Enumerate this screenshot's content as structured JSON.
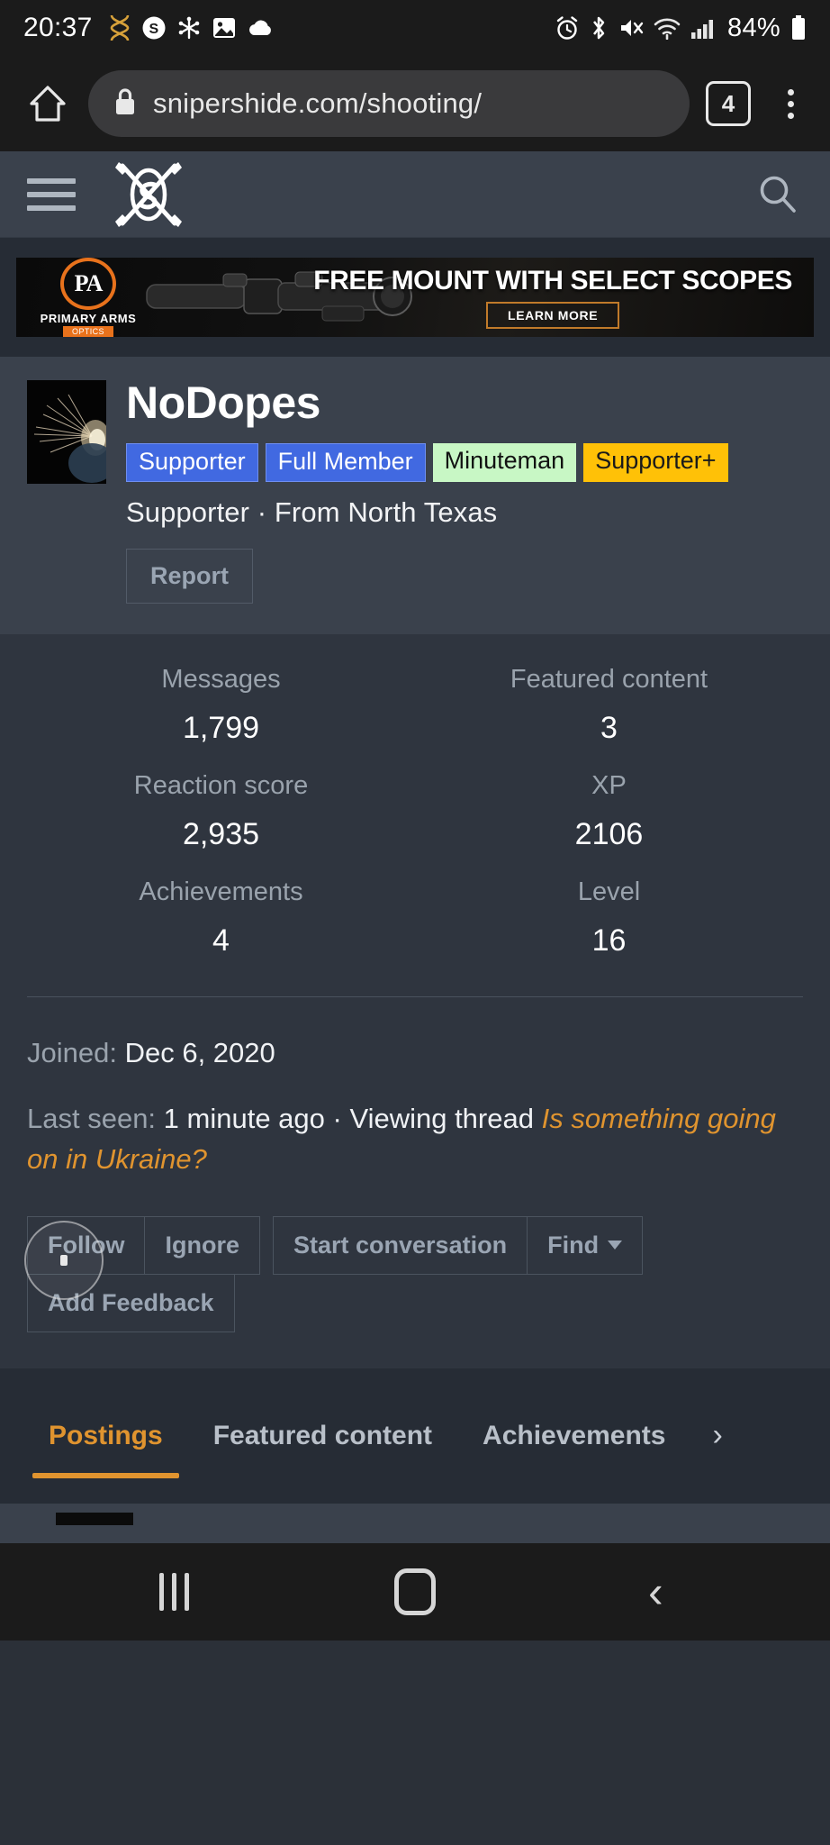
{
  "status_bar": {
    "time": "20:37",
    "left_icons": [
      "dna-icon",
      "s-circle-icon",
      "snowflake-icon",
      "photo-icon",
      "cloud-icon"
    ],
    "right_icons": [
      "alarm-icon",
      "bluetooth-icon",
      "mute-icon",
      "wifi-icon",
      "signal-icon"
    ],
    "battery_percent": "84%"
  },
  "browser": {
    "home_label": "home-icon",
    "lock_label": "lock-icon",
    "url": "snipershide.com/shooting/",
    "tab_count": "4",
    "menu_label": "more-options-icon"
  },
  "site_header": {
    "menu_label": "hamburger-icon",
    "logo_label": "snipers-hide-logo",
    "search_label": "search-icon"
  },
  "ad": {
    "brand_initials": "PA",
    "brand_name": "PRIMARY ARMS",
    "brand_sub": "OPTICS",
    "headline": "FREE MOUNT WITH SELECT SCOPES",
    "cta": "LEARN MORE"
  },
  "profile": {
    "username": "NoDopes",
    "badges": [
      {
        "label": "Supporter",
        "style": "blue"
      },
      {
        "label": "Full Member",
        "style": "blue"
      },
      {
        "label": "Minuteman",
        "style": "green"
      },
      {
        "label": "Supporter+",
        "style": "gold"
      }
    ],
    "title_line": "Supporter · From North Texas",
    "report_label": "Report"
  },
  "stats": [
    {
      "label": "Messages",
      "value": "1,799"
    },
    {
      "label": "Featured content",
      "value": "3"
    },
    {
      "label": "Reaction score",
      "value": "2,935"
    },
    {
      "label": "XP",
      "value": "2106"
    },
    {
      "label": "Achievements",
      "value": "4"
    },
    {
      "label": "Level",
      "value": "16"
    }
  ],
  "info": {
    "joined_label": "Joined:",
    "joined_value": "Dec 6, 2020",
    "last_seen_label": "Last seen:",
    "last_seen_value": "1 minute ago · Viewing thread ",
    "thread_title": "Is something going on in Ukraine?"
  },
  "actions": {
    "follow": "Follow",
    "ignore": "Ignore",
    "start_conversation": "Start conversation",
    "find": "Find",
    "add_feedback": "Add Feedback"
  },
  "tabs": [
    {
      "label": "Postings",
      "active": true
    },
    {
      "label": "Featured content",
      "active": false
    },
    {
      "label": "Achievements",
      "active": false
    }
  ],
  "tabs_more": "›",
  "nav_bar": {
    "recents": "recents-icon",
    "home": "home-icon",
    "back": "back-icon"
  },
  "colors": {
    "accent": "#e0942f",
    "badge_blue": "#4169e1",
    "badge_green": "#c8f7c5",
    "badge_gold": "#ffc107",
    "page_bg": "#2f353f",
    "header_bg": "#3a414c"
  }
}
